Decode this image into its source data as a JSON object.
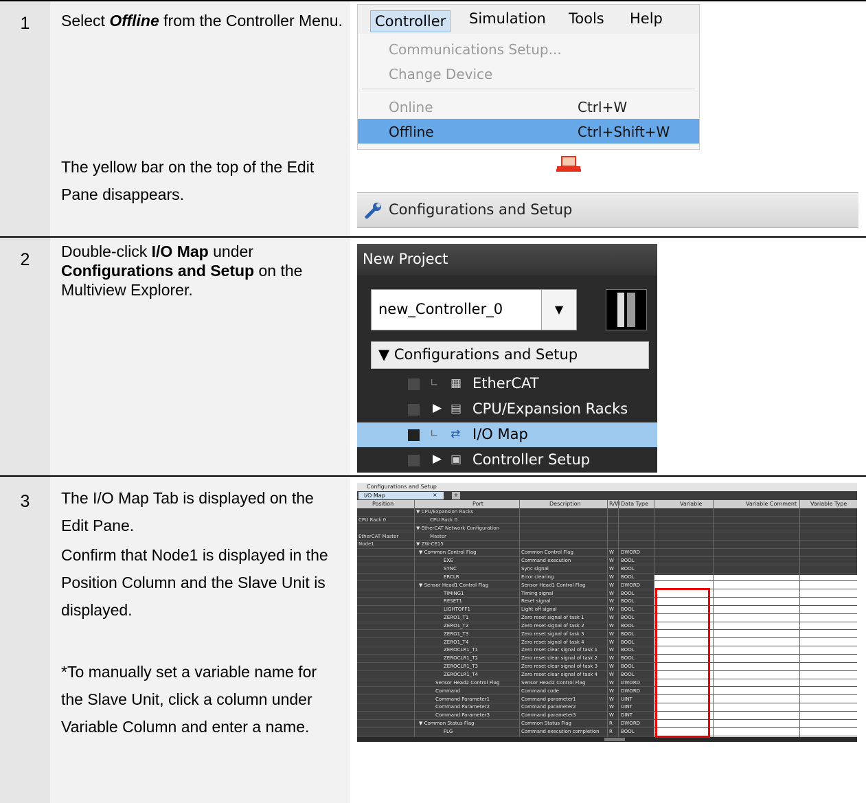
{
  "steps": [
    {
      "number": "1",
      "text_a_pre": "Select ",
      "text_a_em": "Offline",
      "text_a_post": " from the Controller Menu.",
      "text_b": "The yellow bar on the top of the Edit Pane disappears."
    },
    {
      "number": "2",
      "pre": "Double-click ",
      "b1": "I/O Map",
      "mid": " under ",
      "b2": "Configurations and Setup",
      "post": " on the Multiview Explorer."
    },
    {
      "number": "3",
      "text_a": "The I/O Map Tab is displayed on the Edit Pane.",
      "text_b": "Confirm that Node1 is displayed in the Position Column and the Slave Unit is displayed.",
      "text_c": "*To manually set a variable name for the Slave Unit, click a column under Variable Column and enter a name."
    }
  ],
  "menu": {
    "bar": [
      "Controller",
      "Simulation",
      "Tools",
      "Help"
    ],
    "items": [
      {
        "label": "Communications Setup...",
        "shortcut": "",
        "disabled": true
      },
      {
        "label": "Change Device",
        "shortcut": "",
        "disabled": true
      },
      {
        "label": "Online",
        "shortcut": "Ctrl+W",
        "disabled": true
      },
      {
        "label": "Offline",
        "shortcut": "Ctrl+Shift+W",
        "disabled": false
      }
    ]
  },
  "config_bar": {
    "title": "Configurations and Setup"
  },
  "explorer": {
    "header": "New Project",
    "controller": "new_Controller_0",
    "section": "▼ Configurations and Setup",
    "items": [
      {
        "label": "EtherCAT",
        "icon": "ethercat-icon",
        "expander": "∟"
      },
      {
        "label": "CPU/Expansion Racks",
        "icon": "rack-icon",
        "expander": "▶"
      },
      {
        "label": "I/O Map",
        "icon": "iomap-icon",
        "expander": "∟"
      },
      {
        "label": "Controller Setup",
        "icon": "setup-icon",
        "expander": "▶"
      }
    ]
  },
  "iomap": {
    "window_title": "Configurations and Setup",
    "tab": "I/O Map",
    "columns": [
      "Position",
      "Port",
      "Description",
      "R/W",
      "Data Type",
      "Variable",
      "Variable Comment",
      "Variable Type"
    ],
    "rows": [
      [
        "",
        "▼ CPU/Expansion Racks",
        "",
        "",
        ""
      ],
      [
        "CPU Rack 0",
        "CPU Rack 0",
        "",
        "",
        ""
      ],
      [
        "",
        "▼ EtherCAT Network Configuration",
        "",
        "",
        ""
      ],
      [
        "EtherCAT Master",
        "Master",
        "",
        "",
        ""
      ],
      [
        "Node1",
        "▼ ZW-CE15",
        "",
        "",
        ""
      ],
      [
        "",
        "▼ Common Control Flag",
        "Common Control Flag",
        "W",
        "DWORD"
      ],
      [
        "",
        "EXE",
        "Command execution",
        "W",
        "BOOL"
      ],
      [
        "",
        "SYNC",
        "Sync signal",
        "W",
        "BOOL"
      ],
      [
        "",
        "ERCLR",
        "Error clearing",
        "W",
        "BOOL"
      ],
      [
        "",
        "▼ Sensor Head1 Control Flag",
        "Sensor Head1 Control Flag",
        "W",
        "DWORD"
      ],
      [
        "",
        "TIMING1",
        "Timing signal",
        "W",
        "BOOL"
      ],
      [
        "",
        "RESET1",
        "Reset signal",
        "W",
        "BOOL"
      ],
      [
        "",
        "LIGHTOFF1",
        "Light off signal",
        "W",
        "BOOL"
      ],
      [
        "",
        "ZERO1_T1",
        "Zero reset signal of task 1",
        "W",
        "BOOL"
      ],
      [
        "",
        "ZERO1_T2",
        "Zero reset signal of task 2",
        "W",
        "BOOL"
      ],
      [
        "",
        "ZERO1_T3",
        "Zero reset signal of task 3",
        "W",
        "BOOL"
      ],
      [
        "",
        "ZERO1_T4",
        "Zero reset signal of task 4",
        "W",
        "BOOL"
      ],
      [
        "",
        "ZEROCLR1_T1",
        "Zero reset clear signal of task 1",
        "W",
        "BOOL"
      ],
      [
        "",
        "ZEROCLR1_T2",
        "Zero reset clear signal of task 2",
        "W",
        "BOOL"
      ],
      [
        "",
        "ZEROCLR1_T3",
        "Zero reset clear signal of task 3",
        "W",
        "BOOL"
      ],
      [
        "",
        "ZEROCLR1_T4",
        "Zero reset clear signal of task 4",
        "W",
        "BOOL"
      ],
      [
        "",
        "Sensor Head2 Control Flag",
        "Sensor Head2 Control Flag",
        "W",
        "DWORD"
      ],
      [
        "",
        "Command",
        "Command code",
        "W",
        "DWORD"
      ],
      [
        "",
        "Command Parameter1",
        "Command parameter1",
        "W",
        "UINT"
      ],
      [
        "",
        "Command Parameter2",
        "Command parameter2",
        "W",
        "UINT"
      ],
      [
        "",
        "Command Parameter3",
        "Command parameter3",
        "W",
        "DINT"
      ],
      [
        "",
        "▼ Common Status Flag",
        "Common Status Flag",
        "R",
        "DWORD"
      ],
      [
        "",
        "FLG",
        "Command execution completion",
        "R",
        "BOOL"
      ]
    ]
  }
}
